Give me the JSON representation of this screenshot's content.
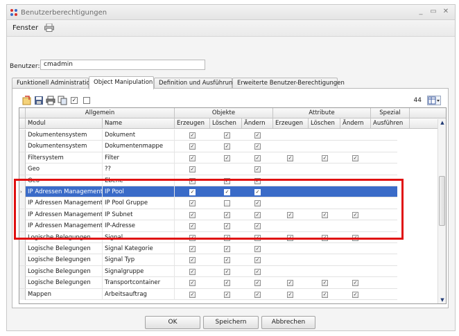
{
  "window": {
    "title": "Benutzerberechtigungen"
  },
  "icons": {
    "app": "app-icon",
    "print": "printer-icon",
    "minimize": "minimize-icon",
    "maximize": "maximize-icon",
    "close": "close-icon"
  },
  "menu": {
    "fenster": "Fenster"
  },
  "user": {
    "label": "Benutzer:",
    "value": "cmadmin"
  },
  "tabs": [
    {
      "label": "Funktionell Administration"
    },
    {
      "label": "Object Manipulation"
    },
    {
      "label": "Definition und Ausführung"
    },
    {
      "label": "Erweiterte Benutzer-Berechtigungen"
    }
  ],
  "toolbar": {
    "icons": [
      "export-icon",
      "save-icon",
      "print-icon",
      "copy-icon"
    ],
    "check_all": "✓",
    "count": "44"
  },
  "grid": {
    "groups": {
      "allgemein": "Allgemein",
      "objekte": "Objekte",
      "attribute": "Attribute",
      "spezial": "Spezial"
    },
    "columns": {
      "modul": "Modul",
      "name": "Name",
      "erzeugen": "Erzeugen",
      "loeschen": "Löschen",
      "aendern": "Ändern",
      "a_erzeugen": "Erzeugen",
      "a_loeschen": "Löschen",
      "a_aendern": "Ändern",
      "ausfuehren": "Ausführen"
    },
    "rows": [
      {
        "modul": "Dokumentensystem",
        "name": "Dokument",
        "c": [
          1,
          1,
          1,
          null,
          null,
          null,
          null
        ]
      },
      {
        "modul": "Dokumentensystem",
        "name": "Dokumentenmappe",
        "c": [
          1,
          1,
          1,
          null,
          null,
          null,
          null
        ]
      },
      {
        "modul": "Filtersystem",
        "name": "Filter",
        "c": [
          1,
          1,
          1,
          1,
          1,
          1,
          null
        ]
      },
      {
        "modul": "Geo",
        "name": "??",
        "c": [
          1,
          null,
          1,
          null,
          null,
          null,
          null
        ]
      },
      {
        "modul": "Geo",
        "name": "Ebene",
        "c": [
          1,
          1,
          1,
          null,
          null,
          null,
          null
        ]
      },
      {
        "modul": "IP Adressen Management",
        "name": "IP Pool",
        "c": [
          1,
          1,
          1,
          null,
          null,
          null,
          null
        ],
        "selected": true
      },
      {
        "modul": "IP Adressen Management",
        "name": "IP Pool Gruppe",
        "c": [
          1,
          0,
          1,
          null,
          null,
          null,
          null
        ]
      },
      {
        "modul": "IP Adressen Management",
        "name": "IP Subnet",
        "c": [
          1,
          1,
          1,
          1,
          1,
          1,
          null
        ]
      },
      {
        "modul": "IP Adressen Management",
        "name": "IP-Adresse",
        "c": [
          1,
          1,
          1,
          null,
          null,
          null,
          null
        ]
      },
      {
        "modul": "Logische Belegungen",
        "name": "Signal",
        "c": [
          1,
          1,
          1,
          1,
          1,
          1,
          null
        ]
      },
      {
        "modul": "Logische Belegungen",
        "name": "Signal Kategorie",
        "c": [
          1,
          1,
          1,
          null,
          null,
          null,
          null
        ]
      },
      {
        "modul": "Logische Belegungen",
        "name": "Signal Typ",
        "c": [
          1,
          1,
          1,
          null,
          null,
          null,
          null
        ]
      },
      {
        "modul": "Logische Belegungen",
        "name": "Signalgruppe",
        "c": [
          1,
          1,
          1,
          null,
          null,
          null,
          null
        ]
      },
      {
        "modul": "Logische Belegungen",
        "name": "Transportcontainer",
        "c": [
          1,
          1,
          1,
          1,
          1,
          1,
          null
        ]
      },
      {
        "modul": "Mappen",
        "name": "Arbeitsauftrag",
        "c": [
          1,
          1,
          1,
          1,
          1,
          1,
          null
        ]
      }
    ]
  },
  "buttons": {
    "ok": "OK",
    "speichern": "Speichern",
    "abbrechen": "Abbrechen"
  },
  "colors": {
    "selection": "#3a6bc8",
    "highlight": "#e01010"
  }
}
